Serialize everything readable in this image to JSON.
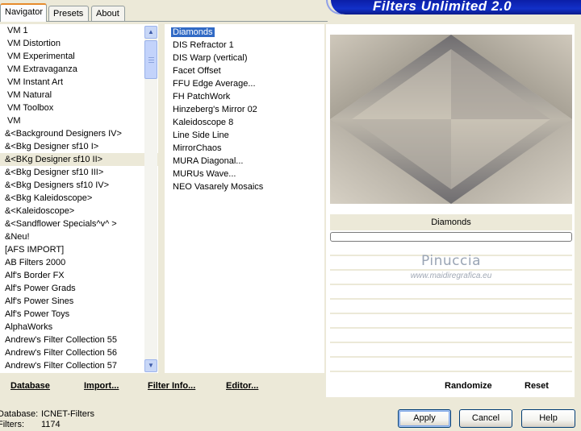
{
  "tabs": [
    {
      "label": "Navigator",
      "active": true
    },
    {
      "label": "Presets",
      "active": false
    },
    {
      "label": "About",
      "active": false
    }
  ],
  "banner": {
    "title": "Filters Unlimited 2.0"
  },
  "categories": {
    "items": [
      "VM 1",
      "VM Distortion",
      "VM Experimental",
      "VM Extravaganza",
      "VM Instant Art",
      "VM Natural",
      "VM Toolbox",
      "VM",
      "&<Background Designers IV>",
      "&<Bkg Designer sf10 I>",
      "&<BKg Designer sf10 II>",
      "&<Bkg Designer sf10 III>",
      "&<Bkg Designers sf10 IV>",
      "&<Bkg Kaleidoscope>",
      "&<Kaleidoscope>",
      "&<Sandflower Specials^v^ >",
      "&Neu!",
      "[AFS IMPORT]",
      "AB Filters 2000",
      "Alf's Border FX",
      "Alf's Power Grads",
      "Alf's Power Sines",
      "Alf's Power Toys",
      "AlphaWorks",
      "Andrew's Filter Collection 55",
      "Andrew's Filter Collection 56",
      "Andrew's Filter Collection 57"
    ],
    "selected_index": 10
  },
  "filters": {
    "items": [
      "Diamonds",
      "DIS Refractor 1",
      "DIS Warp (vertical)",
      "Facet Offset",
      "FFU Edge Average...",
      "FH PatchWork",
      "Hinzeberg's Mirror 02",
      "Kaleidoscope 8",
      "Line Side Line",
      "MirrorChaos",
      "MURA Diagonal...",
      "MURUs Wave...",
      "NEO Vasarely Mosaics"
    ],
    "selected_index": 0
  },
  "preview": {
    "filter_name": "Diamonds",
    "watermark_name": "Pinuccia",
    "watermark_url": "www.maidiregrafica.eu"
  },
  "links": {
    "database": "Database",
    "import": "Import...",
    "filter_info": "Filter Info...",
    "editor": "Editor...",
    "randomize": "Randomize",
    "reset": "Reset"
  },
  "footer": {
    "database_label": "Database:",
    "database_value": "ICNET-Filters",
    "filters_label": "Filters:",
    "filters_value": "1174"
  },
  "buttons": {
    "apply": "Apply",
    "cancel": "Cancel",
    "help": "Help"
  },
  "colors": {
    "window_bg": "#ece9d8",
    "selection": "#316ac5",
    "banner": "#1230c8"
  }
}
